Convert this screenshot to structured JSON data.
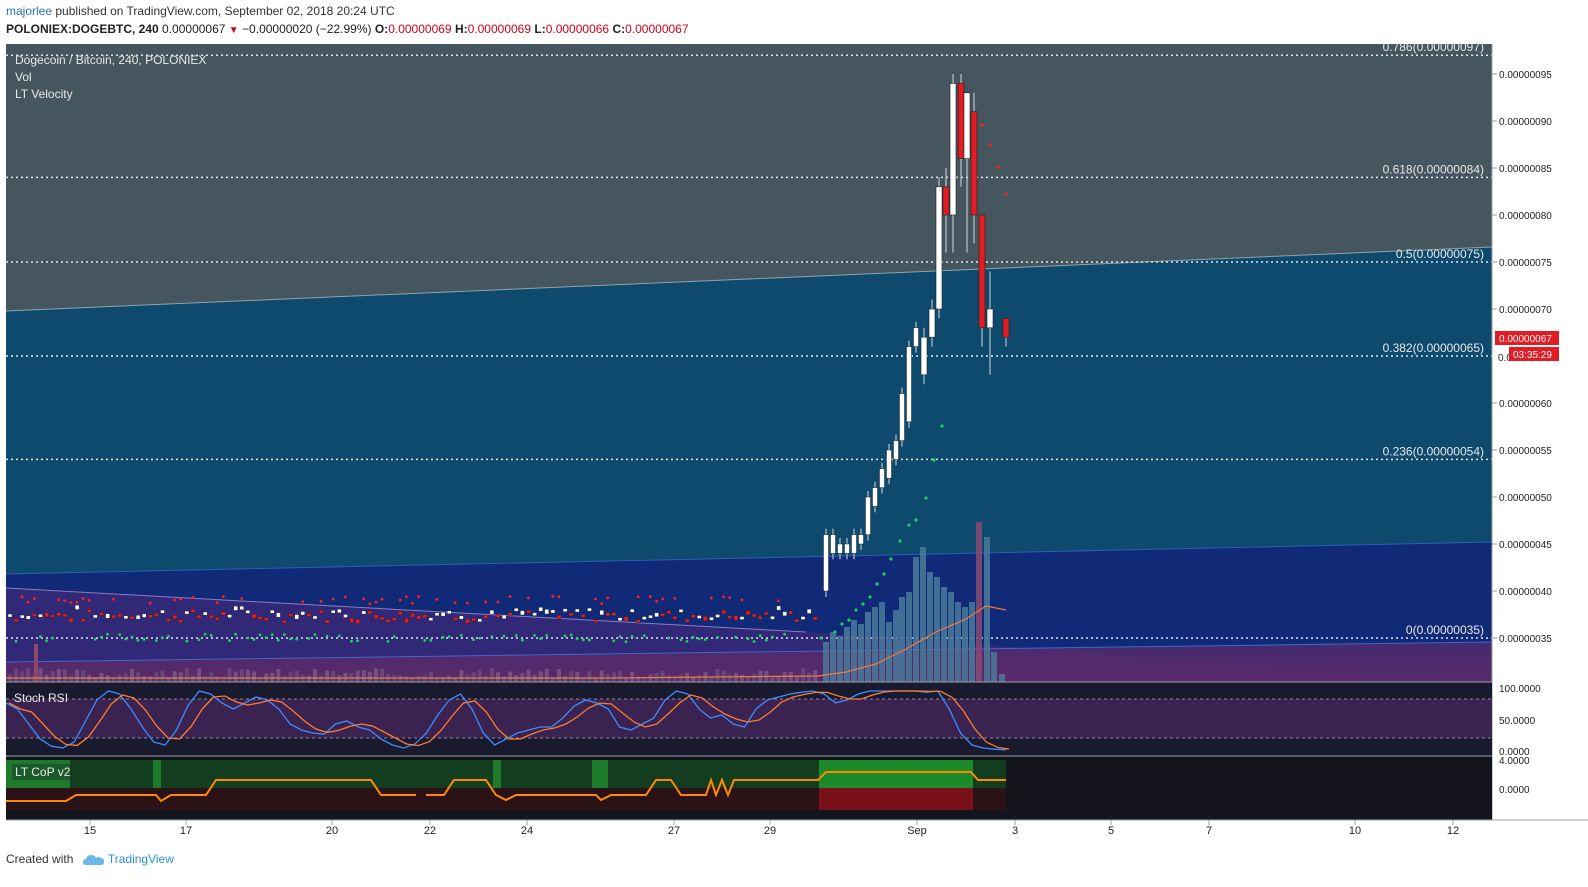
{
  "header": {
    "author": "majorlee",
    "published_text": "published on TradingView.com, September 02, 2018 20:24 UTC",
    "symbol": "POLONIEX:DOGEBTC, 240",
    "last": "0.00000067",
    "change": "−0.00000020 (−22.99%)",
    "o_label": "O:",
    "o_value": "0.00000069",
    "h_label": "H:",
    "h_value": "0.00000069",
    "l_label": "L:",
    "l_value": "0.00000066",
    "c_label": "C:",
    "c_value": "0.00000067"
  },
  "legend": {
    "title": "Dogecoin / Bitcoin, 240, POLONIEX",
    "vol": "Vol",
    "velocity": "LT Velocity"
  },
  "panes": {
    "stoch_label": "Stoch RSI",
    "cop_label": "LT CoP v2"
  },
  "price_badge": {
    "price": "0.00000067",
    "countdown": "03:35:29"
  },
  "colors": {
    "up": "#ffffff",
    "down": "#e31b23",
    "stoch_k": "#3d8bff",
    "stoch_d": "#ff7b2e",
    "cop_line": "#ff8a00",
    "green_dot": "#19d45a",
    "red_dot": "#ff2020"
  },
  "chart_data": {
    "type": "candlestick",
    "y_axis": {
      "min": 3.1e-07,
      "max": 9.8e-07,
      "ticks": [
        "0.00000095",
        "0.00000090",
        "0.00000085",
        "0.00000080",
        "0.00000075",
        "0.00000070",
        "0.00000060",
        "0.00000055",
        "0.00000050",
        "0.00000045",
        "0.00000040",
        "0.00000035"
      ],
      "partial_tick": "0.0"
    },
    "x_axis": {
      "ticks": [
        "15",
        "17",
        "20",
        "22",
        "24",
        "27",
        "29",
        "Sep",
        "3",
        "5",
        "7",
        "10",
        "12"
      ]
    },
    "fib_levels": [
      {
        "label": "0.786(0.00000097)",
        "value": 9.7e-07
      },
      {
        "label": "0.618(0.00000084)",
        "value": 8.4e-07
      },
      {
        "label": "0.5(0.00000075)",
        "value": 7.5e-07
      },
      {
        "label": "0.382(0.00000065)",
        "value": 6.5e-07
      },
      {
        "label": "0.236(0.00000054)",
        "value": 5.4e-07
      },
      {
        "label": "0(0.00000035)",
        "value": 3.5e-07
      }
    ],
    "candles": [
      {
        "date": "Sep 01",
        "o": 6.3e-07,
        "h": 6.8e-07,
        "l": 6.2e-07,
        "c": 6.7e-07
      },
      {
        "date": "Sep 01",
        "o": 6.7e-07,
        "h": 7.1e-07,
        "l": 6.6e-07,
        "c": 7e-07
      },
      {
        "date": "Sep 01",
        "o": 7e-07,
        "h": 8.4e-07,
        "l": 6.9e-07,
        "c": 8.3e-07
      },
      {
        "date": "Sep 01",
        "o": 8.3e-07,
        "h": 8.5e-07,
        "l": 7.6e-07,
        "c": 8e-07
      },
      {
        "date": "Sep 01",
        "o": 8e-07,
        "h": 9.5e-07,
        "l": 7.6e-07,
        "c": 9.4e-07
      },
      {
        "date": "Sep 01",
        "o": 9.4e-07,
        "h": 9.5e-07,
        "l": 8.3e-07,
        "c": 8.6e-07
      },
      {
        "date": "Sep 02",
        "o": 8.6e-07,
        "h": 9.3e-07,
        "l": 7.6e-07,
        "c": 9.3e-07
      },
      {
        "date": "Sep 02",
        "o": 9.1e-07,
        "h": 9.3e-07,
        "l": 7.7e-07,
        "c": 8e-07
      },
      {
        "date": "Sep 02",
        "o": 8e-07,
        "h": 8e-07,
        "l": 6.6e-07,
        "c": 6.8e-07
      },
      {
        "date": "Sep 02",
        "o": 6.8e-07,
        "h": 7.4e-07,
        "l": 6.3e-07,
        "c": 7e-07
      },
      {
        "date": "Sep 02",
        "o": 6.9e-07,
        "h": 6.9e-07,
        "l": 6.6e-07,
        "c": 6.7e-07
      }
    ],
    "stoch_rsi": {
      "ticks": [
        "100.0000",
        "50.0000",
        "0.0000"
      ]
    },
    "lt_cop": {
      "ticks": [
        "4.0000",
        "0.0000"
      ]
    }
  },
  "footer": {
    "created_with": "Created with",
    "brand": "TradingView"
  }
}
